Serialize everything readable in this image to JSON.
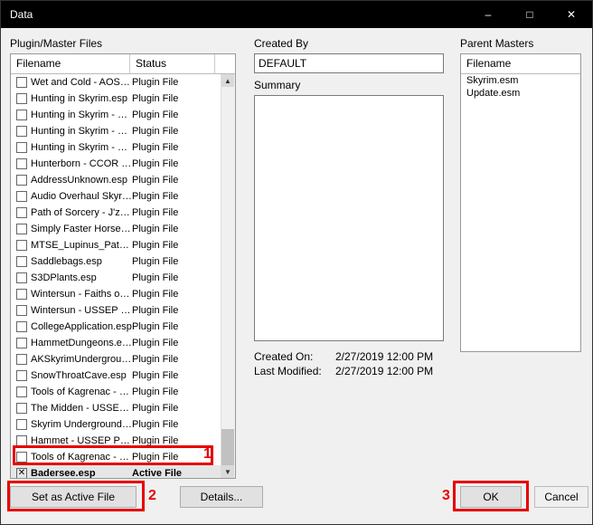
{
  "window": {
    "title": "Data"
  },
  "left": {
    "label": "Plugin/Master Files",
    "columns": {
      "filename": "Filename",
      "status": "Status"
    },
    "plugins": [
      {
        "name": "Wet and Cold - AOS P...",
        "status": "Plugin File",
        "checked": false
      },
      {
        "name": "Hunting in Skyrim.esp",
        "status": "Plugin File",
        "checked": false
      },
      {
        "name": "Hunting in Skyrim - CC...",
        "status": "Plugin File",
        "checked": false
      },
      {
        "name": "Hunting in Skyrim - US...",
        "status": "Plugin File",
        "checked": false
      },
      {
        "name": "Hunting in Skyrim - CC...",
        "status": "Plugin File",
        "checked": false
      },
      {
        "name": "Hunterborn - CCOR P...",
        "status": "Plugin File",
        "checked": false
      },
      {
        "name": "AddressUnknown.esp",
        "status": "Plugin File",
        "checked": false
      },
      {
        "name": "Audio Overhaul Skyrim...",
        "status": "Plugin File",
        "checked": false
      },
      {
        "name": "Path of Sorcery - J'zar...",
        "status": "Plugin File",
        "checked": false
      },
      {
        "name": "Simply Faster Horses (...",
        "status": "Plugin File",
        "checked": false
      },
      {
        "name": "MTSE_Lupinus_Patch...",
        "status": "Plugin File",
        "checked": false
      },
      {
        "name": "Saddlebags.esp",
        "status": "Plugin File",
        "checked": false
      },
      {
        "name": "S3DPlants.esp",
        "status": "Plugin File",
        "checked": false
      },
      {
        "name": "Wintersun - Faiths of S...",
        "status": "Plugin File",
        "checked": false
      },
      {
        "name": "Wintersun - USSEP P...",
        "status": "Plugin File",
        "checked": false
      },
      {
        "name": "CollegeApplication.esp",
        "status": "Plugin File",
        "checked": false
      },
      {
        "name": "HammetDungeons.esp",
        "status": "Plugin File",
        "checked": false
      },
      {
        "name": "AKSkyrimUnderground...",
        "status": "Plugin File",
        "checked": false
      },
      {
        "name": "SnowThroatCave.esp",
        "status": "Plugin File",
        "checked": false
      },
      {
        "name": "Tools of Kagrenac - U...",
        "status": "Plugin File",
        "checked": false
      },
      {
        "name": "The Midden - USSEP ...",
        "status": "Plugin File",
        "checked": false
      },
      {
        "name": "Skyrim Underground  ...",
        "status": "Plugin File",
        "checked": false
      },
      {
        "name": "Hammet - USSEP Pat...",
        "status": "Plugin File",
        "checked": false
      },
      {
        "name": "Tools of Kagrenac - F...",
        "status": "Plugin File",
        "checked": false
      },
      {
        "name": "Badersee.esp",
        "status": "Active File",
        "checked": true,
        "selected": true
      }
    ],
    "buttons": {
      "set_active": "Set as Active File",
      "details": "Details..."
    }
  },
  "created_by": {
    "label": "Created By",
    "value": "DEFAULT"
  },
  "summary": {
    "label": "Summary",
    "value": ""
  },
  "meta": {
    "created_on_label": "Created On:",
    "created_on_value": "2/27/2019  12:00 PM",
    "last_modified_label": "Last Modified:",
    "last_modified_value": "2/27/2019  12:00 PM"
  },
  "parents": {
    "label": "Parent Masters",
    "column": "Filename",
    "items": [
      "Skyrim.esm",
      "Update.esm"
    ]
  },
  "footer": {
    "ok": "OK",
    "cancel": "Cancel"
  },
  "annotations": {
    "n1": "1",
    "n2": "2",
    "n3": "3"
  }
}
